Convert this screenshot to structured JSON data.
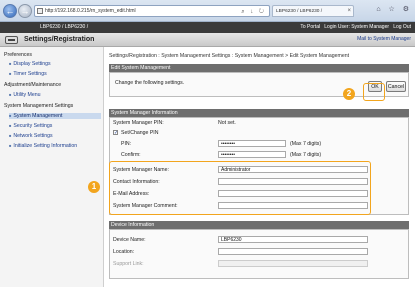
{
  "browser": {
    "back_glyph": "←",
    "forward_glyph": "→",
    "url": "http://192.168.0.215/rn_system_edit.html",
    "address_tools": "⌕ ↓ ↻",
    "tab_title": "LBP6230 / LBP6230 /",
    "tab_close": "×",
    "window_icons": "⌂ ☆ ⚙"
  },
  "device_bar": {
    "device_name": "LBP6230 / LBP6230 /",
    "to_portal": "To Portal",
    "login_user": "Login User: System Manager",
    "log_out": "Log Out"
  },
  "header": {
    "title": "Settings/Registration",
    "mail_link": "Mail to System Manager"
  },
  "sidebar": {
    "preferences": "Preferences",
    "display_settings": "Display Settings",
    "timer_settings": "Timer Settings",
    "adjustment_maintenance": "Adjustment/Maintenance",
    "utility_menu": "Utility Menu",
    "system_management_settings": "System Management Settings",
    "system_management": "System Management",
    "security_settings": "Security Settings",
    "network_settings": "Network Settings",
    "initialize_setting_information": "Initialize Setting Information"
  },
  "content": {
    "breadcrumb": "Settings/Registration : System Management Settings : System Management > Edit System Management",
    "edit_heading": "Edit System Management",
    "instruction": "Change the following settings.",
    "ok_label": "OK",
    "cancel_label": "Cancel",
    "smi_heading": "System Manager Information",
    "pin_label": "System Manager PIN:",
    "pin_status": "Not set.",
    "set_change_pin": "Set/Change PIN",
    "checkmark": "✓",
    "pin_field_label": "PIN:",
    "pin_value": "••••••••",
    "pin_hint": "(Max 7 digits)",
    "confirm_label": "Confirm:",
    "confirm_value": "••••••••",
    "confirm_hint": "(Max 7 digits)",
    "manager_name_label": "System Manager Name:",
    "manager_name_value": "Administrator",
    "contact_label": "Contact Information:",
    "contact_value": "",
    "email_label": "E-Mail Address:",
    "email_value": "",
    "comment_label": "System Manager Comment:",
    "comment_value": "",
    "device_heading": "Device Information",
    "device_name_label": "Device Name:",
    "device_name_value": "LBP6230",
    "location_label": "Location:",
    "location_value": "",
    "support_link_label": "Support Link:",
    "support_link_value": ""
  },
  "callouts": {
    "one": "1",
    "two": "2"
  },
  "colors": {
    "accent": "#f2a51e",
    "dark_bar": "#3a3a3a",
    "section_head": "#6e6e6e",
    "link": "#1d3f8f"
  }
}
